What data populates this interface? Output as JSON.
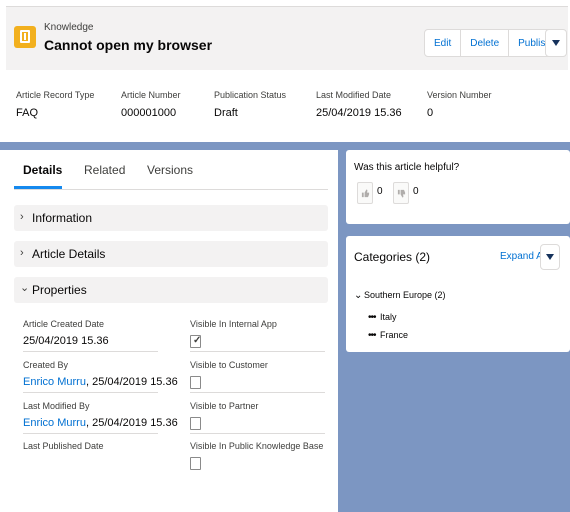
{
  "header": {
    "object_type": "Knowledge",
    "title": "Cannot open my browser",
    "buttons": [
      "Edit",
      "Delete",
      "Publish"
    ]
  },
  "highlights": [
    {
      "label": "Article Record Type",
      "value": "FAQ"
    },
    {
      "label": "Article Number",
      "value": "000001000"
    },
    {
      "label": "Publication Status",
      "value": "Draft"
    },
    {
      "label": "Last Modified Date",
      "value": "25/04/2019 15.36"
    },
    {
      "label": "Version Number",
      "value": "0"
    }
  ],
  "tabs": [
    "Details",
    "Related",
    "Versions"
  ],
  "sections": [
    {
      "title": "Information",
      "chevron": "›"
    },
    {
      "title": "Article Details",
      "chevron": "›"
    },
    {
      "title": "Properties",
      "chevron": "⌄"
    }
  ],
  "properties": {
    "article_created_date": {
      "label": "Article Created Date",
      "value": "25/04/2019 15.36"
    },
    "created_by": {
      "label": "Created By",
      "user": "Enrico Murru",
      "date": ", 25/04/2019 15.36"
    },
    "last_modified_by": {
      "label": "Last Modified By",
      "user": "Enrico Murru",
      "date": ", 25/04/2019 15.36"
    },
    "last_published_date": {
      "label": "Last Published Date",
      "value": ""
    },
    "visible_internal": {
      "label": "Visible In Internal App",
      "checked": true
    },
    "visible_customer": {
      "label": "Visible to Customer",
      "checked": false
    },
    "visible_partner": {
      "label": "Visible to Partner",
      "checked": false
    },
    "visible_public": {
      "label": "Visible In Public Knowledge Base",
      "checked": false
    }
  },
  "helpful": {
    "question": "Was this article helpful?",
    "up_count": "0",
    "down_count": "0"
  },
  "categories": {
    "title": "Categories (2)",
    "expand_all": "Expand All",
    "group": "Southern Europe (2)",
    "items": [
      "Italy",
      "France"
    ]
  },
  "colors": {
    "accent": "#0070d2",
    "background_blue": "#7c96c2",
    "knowledge_icon": "#f2b01e"
  },
  "icons": {
    "object": "knowledge-book-icon",
    "thumbs_up": "thumbs-up-icon",
    "thumbs_down": "thumbs-down-icon"
  }
}
